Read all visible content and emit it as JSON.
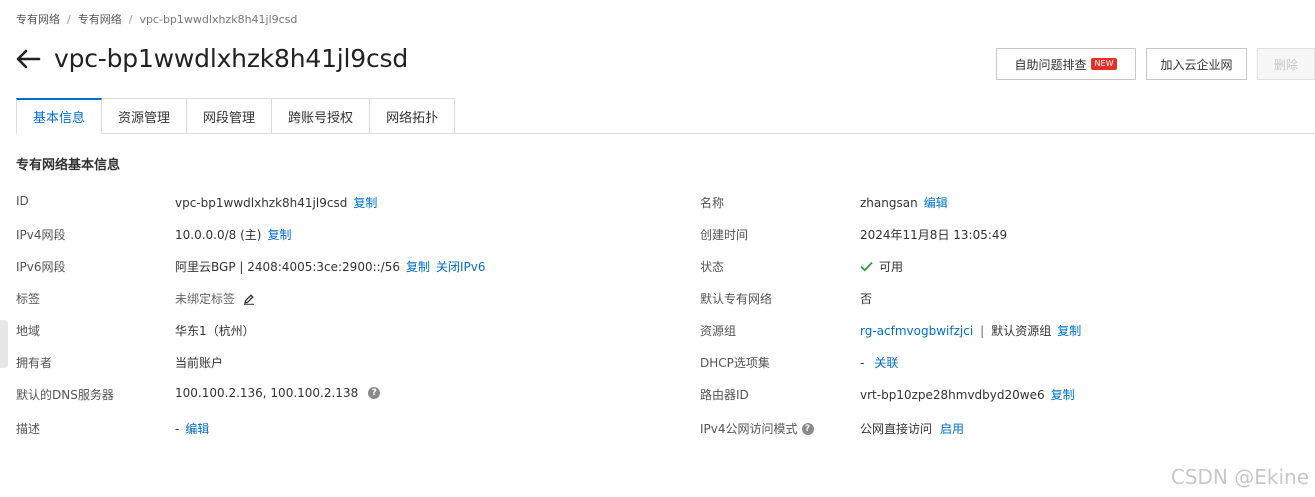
{
  "breadcrumb": {
    "item1": "专有网络",
    "item2": "专有网络",
    "current": "vpc-bp1wwdlxhzk8h41jl9csd"
  },
  "page": {
    "title": "vpc-bp1wwdlxhzk8h41jl9csd"
  },
  "actions": {
    "self_check": "自助问题排查",
    "new_badge": "NEW",
    "join_cen": "加入云企业网",
    "delete": "删除"
  },
  "tabs": [
    {
      "label": "基本信息",
      "active": true
    },
    {
      "label": "资源管理",
      "active": false
    },
    {
      "label": "网段管理",
      "active": false
    },
    {
      "label": "跨账号授权",
      "active": false
    },
    {
      "label": "网络拓扑",
      "active": false
    }
  ],
  "section": {
    "title": "专有网络基本信息"
  },
  "left": {
    "id_label": "ID",
    "id_value": "vpc-bp1wwdlxhzk8h41jl9csd",
    "id_copy": "复制",
    "ipv4_label": "IPv4网段",
    "ipv4_value": "10.0.0.0/8 (主)",
    "ipv4_copy": "复制",
    "ipv6_label": "IPv6网段",
    "ipv6_value": "阿里云BGP | 2408:4005:3ce:2900::/56",
    "ipv6_copy": "复制",
    "ipv6_close": "关闭IPv6",
    "tag_label": "标签",
    "tag_value": "未绑定标签",
    "region_label": "地域",
    "region_value": "华东1（杭州）",
    "owner_label": "拥有者",
    "owner_value": "当前账户",
    "dns_label": "默认的DNS服务器",
    "dns_value": "100.100.2.136, 100.100.2.138",
    "desc_label": "描述",
    "desc_value": "-",
    "desc_edit": "编辑"
  },
  "right": {
    "name_label": "名称",
    "name_value": "zhangsan",
    "name_edit": "编辑",
    "created_label": "创建时间",
    "created_value": "2024年11月8日 13:05:49",
    "status_label": "状态",
    "status_value": "可用",
    "default_label": "默认专有网络",
    "default_value": "否",
    "rg_label": "资源组",
    "rg_value": "rg-acfmvogbwifzjci",
    "rg_sep": "|",
    "rg_name": "默认资源组",
    "rg_copy": "复制",
    "dhcp_label": "DHCP选项集",
    "dhcp_value": "-",
    "dhcp_link": "关联",
    "router_label": "路由器ID",
    "router_value": "vrt-bp10zpe28hmvdbyd20we6",
    "router_copy": "复制",
    "ipv4pub_label": "IPv4公网访问模式",
    "ipv4pub_value": "公网直接访问",
    "ipv4pub_link": "启用"
  },
  "watermark": "CSDN @Ekine",
  "colors": {
    "link": "#0070cc",
    "success": "#2e9e3e",
    "badge": "#e5302a"
  }
}
